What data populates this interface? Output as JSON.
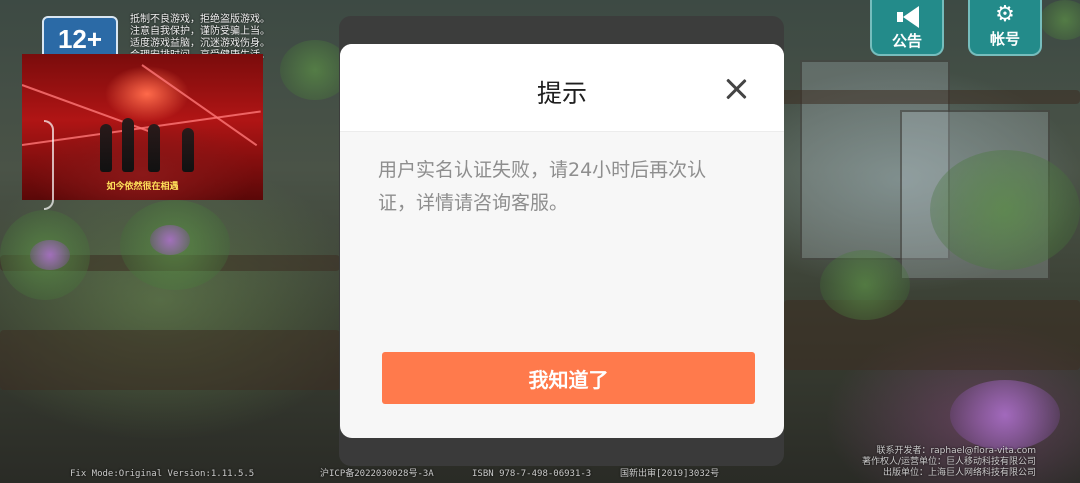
{
  "age_rating": "12+",
  "health_notice": "抵制不良游戏，拒绝盗版游戏。\n注意自我保护，谨防受骗上当。\n适度游戏益脑，沉迷游戏伤身。\n合理安排时间，享受健康生活。",
  "video": {
    "subtitle": "如今依然很在相遇"
  },
  "top_buttons": {
    "announcement": {
      "icon": "megaphone-icon",
      "label": "公告"
    },
    "account": {
      "icon": "gear-icon",
      "label": "帐号"
    }
  },
  "footer": {
    "version": "Fix Mode:Original Version:1.11.5.5",
    "icp": "沪ICP备2022030028号-3A",
    "isbn": "ISBN 978-7-498-06931-3",
    "approval": "国新出审[2019]3032号",
    "publisher_lines": [
      "联系开发者：raphael@flora-vita.com",
      "著作权人/运营单位：巨人移动科技有限公司",
      "出版单位：上海巨人网络科技有限公司"
    ]
  },
  "dialog": {
    "title": "提示",
    "message": "用户实名认证失败，请24小时后再次认证，详情请咨询客服。",
    "confirm_label": "我知道了",
    "close_icon": "close-icon"
  },
  "colors": {
    "confirm_button": "#ff7a4c",
    "message_text": "#8e8e8e",
    "corner_buttons": "#1e9696"
  }
}
